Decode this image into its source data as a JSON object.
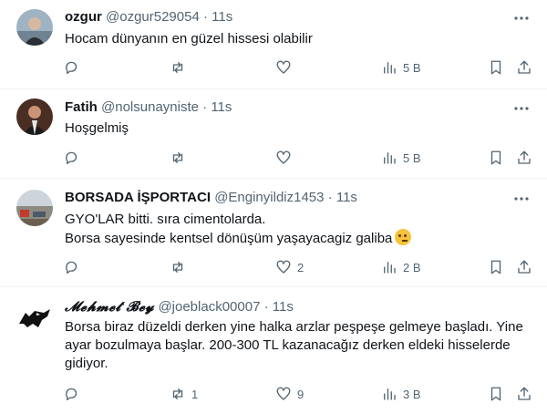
{
  "tweets": [
    {
      "name": "ozgur",
      "handle": "@ozgur529054",
      "sep": "·",
      "time": "11s",
      "lines": [
        "Hocam dünyanın en güzel hissesi olabilir"
      ],
      "reply_count": "",
      "retweet_count": "",
      "like_count": "",
      "views": "5 B"
    },
    {
      "name": "Fatih",
      "handle": "@nolsunayniste",
      "sep": "·",
      "time": "11s",
      "lines": [
        "Hoşgelmiş"
      ],
      "reply_count": "",
      "retweet_count": "",
      "like_count": "",
      "views": "5 B"
    },
    {
      "name": "BORSADA İŞPORTACI",
      "handle": "@Enginyildiz1453",
      "sep": "·",
      "time": "11s",
      "lines": [
        "GYO'LAR bitti. sıra cimentolarda.",
        "Borsa sayesinde kentsel dönüşüm yaşayacagiz galiba"
      ],
      "reply_count": "",
      "retweet_count": "",
      "like_count": "2",
      "views": "2 B"
    },
    {
      "name": "𝓜𝓮𝓱𝓶𝓮𝓽 𝓑𝓮𝔂",
      "handle": "@joeblack00007",
      "sep": "·",
      "time": "11s",
      "lines": [
        "Borsa biraz düzeldi derken yine halka arzlar peşpeşe gelmeye başladı.  Yine",
        "ayar bozulmaya başlar. 200-300 TL kazanacağız derken eldeki hisselerde",
        "gidiyor."
      ],
      "reply_count": "",
      "retweet_count": "1",
      "like_count": "9",
      "views": "3 B"
    }
  ],
  "icons": {
    "more": "more-horizontal-icon",
    "reply": "reply-icon",
    "retweet": "retweet-icon",
    "like": "heart-icon",
    "views": "analytics-icon",
    "bookmark": "bookmark-icon",
    "share": "share-icon",
    "emoji": "thinking-face-emoji"
  },
  "colors": {
    "text": "#0f1419",
    "secondary": "#536471",
    "divider": "#eff3f4"
  }
}
